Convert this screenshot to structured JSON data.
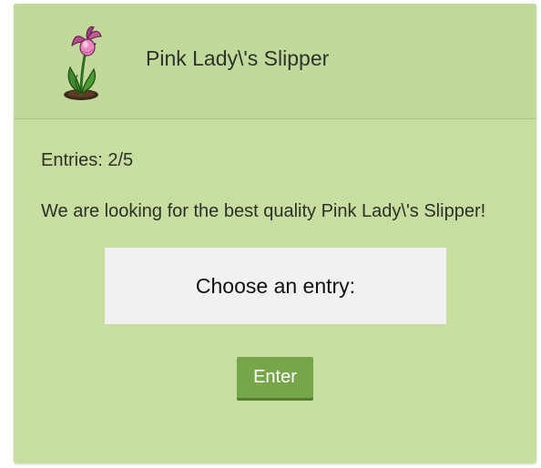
{
  "header": {
    "item_name": "Pink Lady\\'s Slipper",
    "icon": "pink-ladys-slipper-flower-icon"
  },
  "contest": {
    "entries_text": "Entries: 2/5",
    "description": "We are looking for the best quality Pink Lady\\'s Slipper!",
    "choose_label": "Choose an entry:",
    "enter_label": "Enter"
  },
  "colors": {
    "card_background": "#c8dea0",
    "header_background": "#c1d99b",
    "choose_box_background": "#f1f1f1",
    "button_background": "#77a64a",
    "button_text": "#ffffff"
  }
}
